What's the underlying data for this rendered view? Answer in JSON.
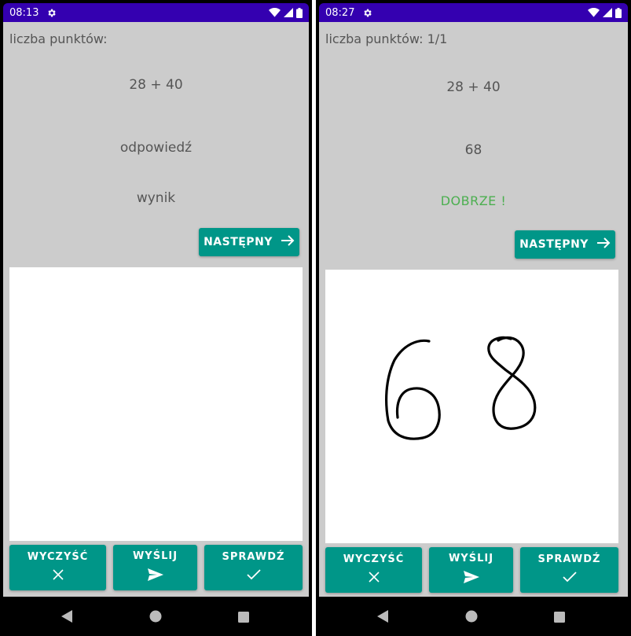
{
  "screens": [
    {
      "status": {
        "time": "08:13"
      },
      "score_label": "liczba punktów:",
      "question": "28 + 40",
      "answer": "odpowiedź",
      "result": "wynik",
      "next_label": "NASTĘPNY",
      "buttons": {
        "clear": "WYCZYŚĆ",
        "send": "WYŚLIJ",
        "check": "SPRAWDŹ"
      }
    },
    {
      "status": {
        "time": "08:27"
      },
      "score_label": "liczba punktów: 1/1",
      "question": "28 + 40",
      "answer": "68",
      "result": "DOBRZE !",
      "next_label": "NASTĘPNY",
      "buttons": {
        "clear": "WYCZYŚĆ",
        "send": "WYŚLIJ",
        "check": "SPRAWDŹ"
      },
      "drawn_digits": "68"
    }
  ],
  "colors": {
    "status_bar": "#3400b0",
    "background": "#cccccc",
    "button": "#009688",
    "result_ok": "#4caf50"
  },
  "icons": {
    "settings": "gear-icon",
    "wifi": "wifi-icon",
    "signal": "signal-icon",
    "battery": "battery-icon",
    "next": "arrow-right-icon",
    "clear": "close-icon",
    "send": "send-icon",
    "check": "check-icon",
    "nav_back": "back-icon",
    "nav_home": "home-icon",
    "nav_recent": "recents-icon"
  }
}
